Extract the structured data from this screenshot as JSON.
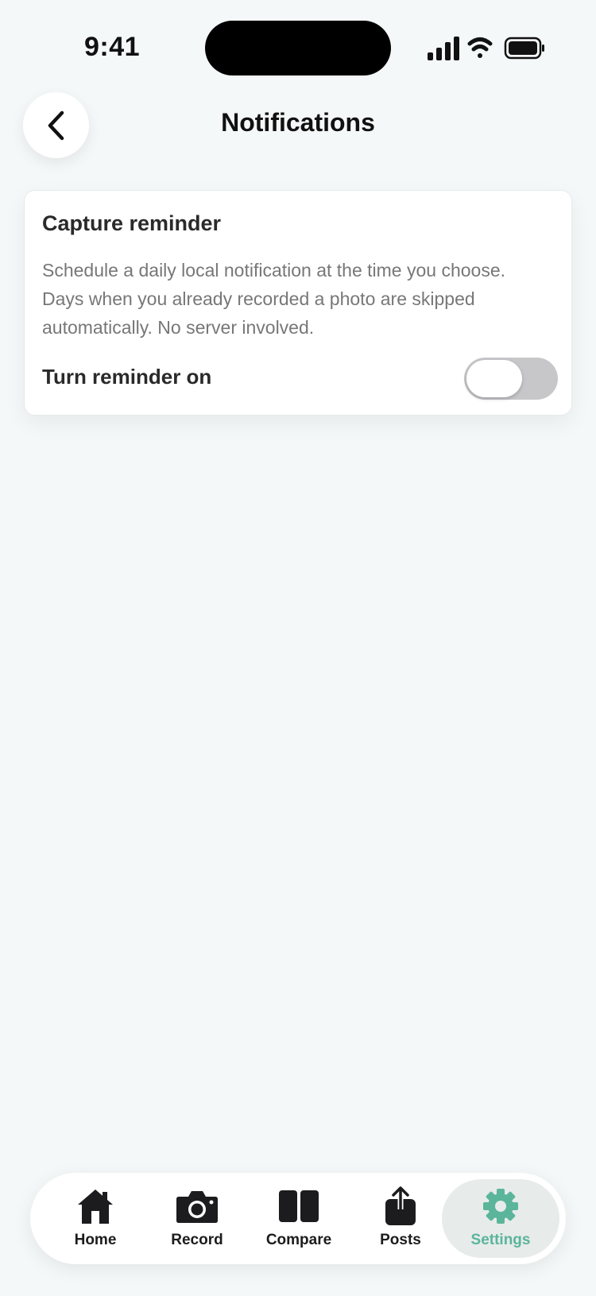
{
  "status_bar": {
    "time": "9:41"
  },
  "header": {
    "title": "Notifications",
    "back_icon": "chevron-left-icon"
  },
  "card": {
    "title": "Capture reminder",
    "description": "Schedule a daily local notification at the time you choose. Days when you already recorded a photo are skipped automatically. No server involved.",
    "toggle_label": "Turn reminder on",
    "toggle_on": false
  },
  "tabbar": {
    "items": [
      {
        "label": "Home",
        "icon": "home-icon"
      },
      {
        "label": "Record",
        "icon": "camera-icon"
      },
      {
        "label": "Compare",
        "icon": "compare-icon"
      },
      {
        "label": "Posts",
        "icon": "share-icon"
      },
      {
        "label": "Settings",
        "icon": "gear-icon",
        "active": true
      }
    ]
  },
  "colors": {
    "accent": "#5bb59b",
    "background": "#f5f8f8",
    "toggle_off": "#c7c7ca"
  }
}
